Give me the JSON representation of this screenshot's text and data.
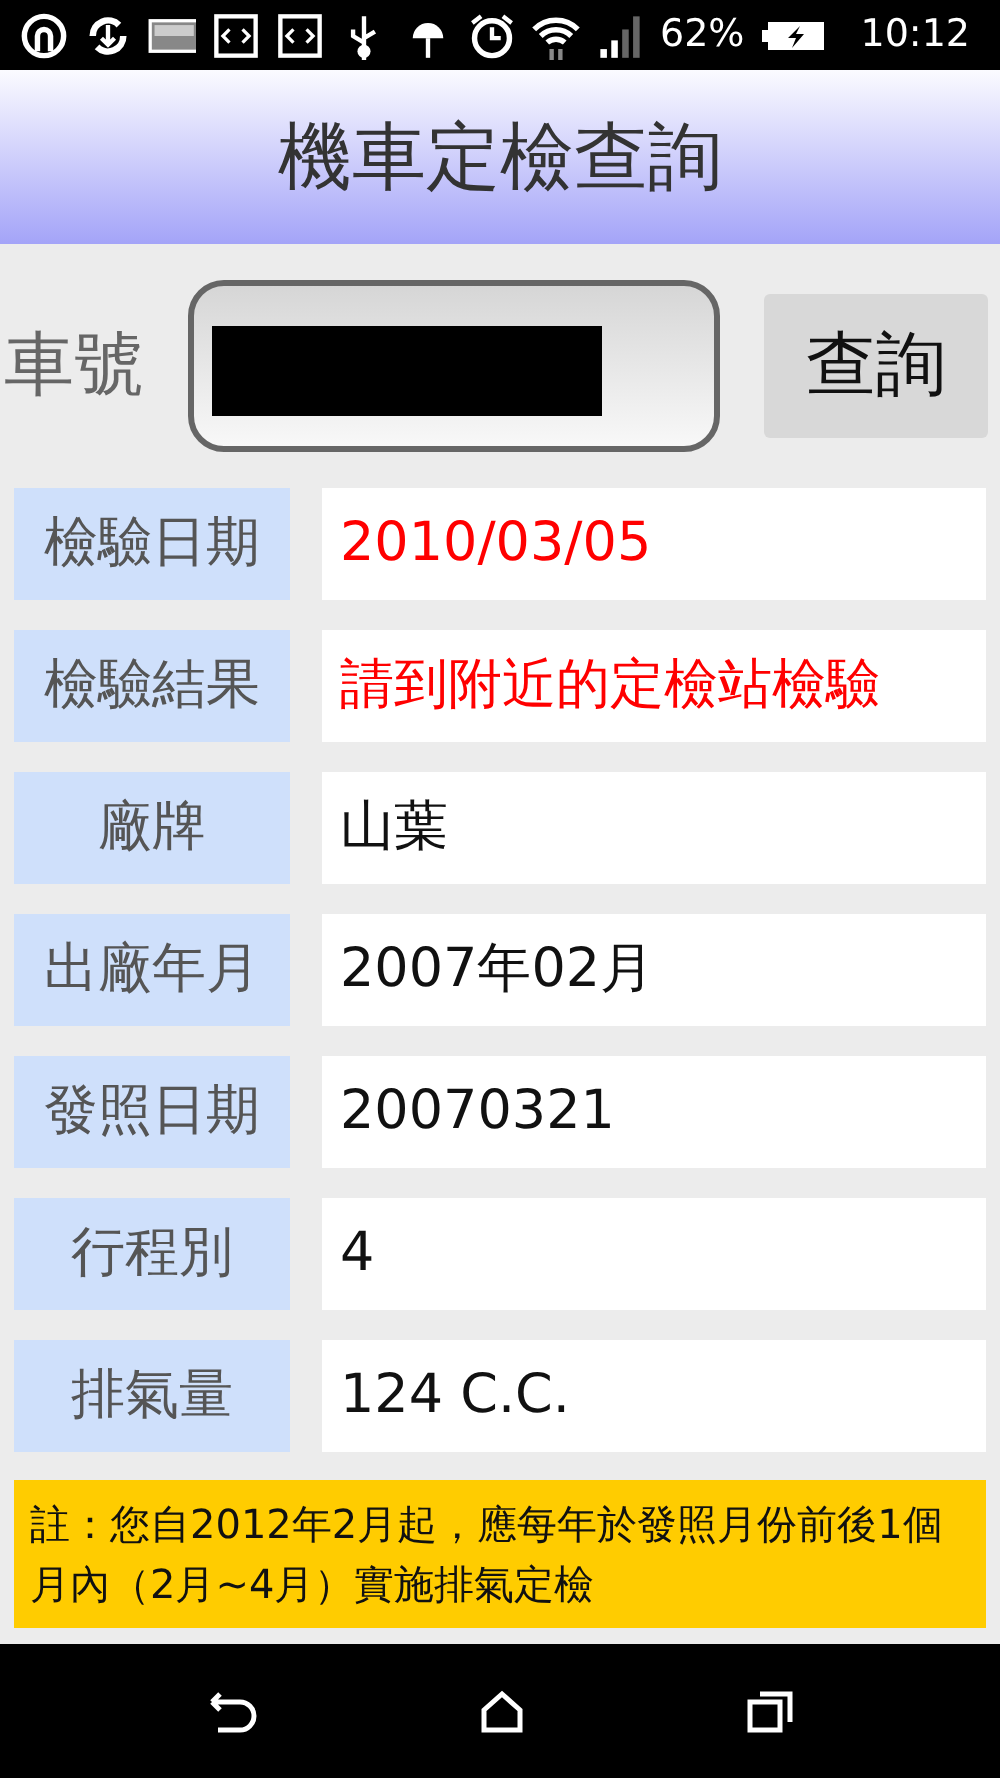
{
  "status_bar": {
    "battery": "62%",
    "time": "10:12"
  },
  "header": {
    "title": "機車定檢查詢"
  },
  "search": {
    "label": "車號",
    "redacted": true,
    "button": "查詢"
  },
  "rows": [
    {
      "label": "檢驗日期",
      "value": "2010/03/05",
      "warning": true
    },
    {
      "label": "檢驗結果",
      "value": "請到附近的定檢站檢驗",
      "warning": true
    },
    {
      "label": "廠牌",
      "value": "山葉",
      "warning": false
    },
    {
      "label": "出廠年月",
      "value": "2007年02月",
      "warning": false
    },
    {
      "label": "發照日期",
      "value": "20070321",
      "warning": false
    },
    {
      "label": "行程別",
      "value": "4",
      "warning": false
    },
    {
      "label": "排氣量",
      "value": "124 C.C.",
      "warning": false
    }
  ],
  "note": "註：您自2012年2月起，應每年於發照月份前後1個月內（2月~4月）實施排氣定檢"
}
